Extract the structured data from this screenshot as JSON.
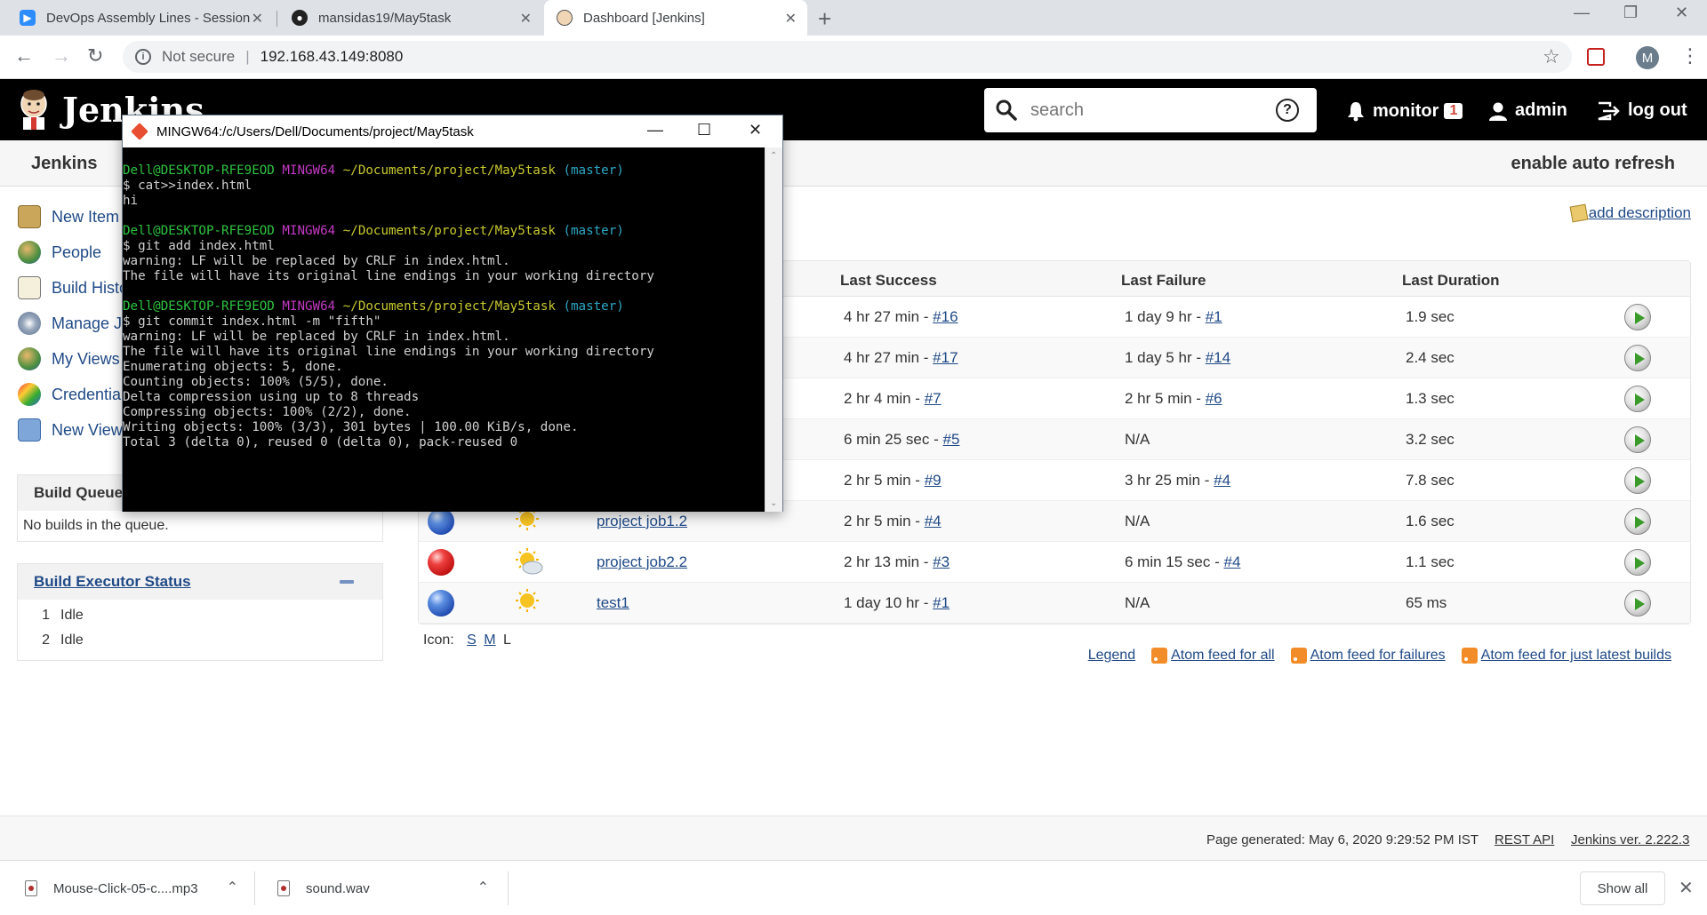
{
  "browser": {
    "tabs": [
      {
        "title": "DevOps Assembly Lines - Session",
        "icon": "zoom-icon",
        "active": false
      },
      {
        "title": "mansidas19/May5task",
        "icon": "github-icon",
        "active": false
      },
      {
        "title": "Dashboard [Jenkins]",
        "icon": "jenkins-icon",
        "active": true
      }
    ],
    "security_label": "Not secure",
    "url": "192.168.43.149:8080",
    "profile_initial": "M"
  },
  "header": {
    "title": "Jenkins",
    "search_placeholder": "search",
    "help": "?",
    "monitor_label": "monitor",
    "monitor_count": "1",
    "user": "admin",
    "logout": "log out"
  },
  "breadcrumb": {
    "home": "Jenkins",
    "auto_refresh": "enable auto refresh"
  },
  "sidebar": {
    "items": [
      {
        "label": "New Item",
        "icon": "new-item-icon"
      },
      {
        "label": "People",
        "icon": "people-icon"
      },
      {
        "label": "Build History",
        "icon": "build-history-icon"
      },
      {
        "label": "Manage Jenkins",
        "icon": "manage-icon"
      },
      {
        "label": "My Views",
        "icon": "my-views-icon"
      },
      {
        "label": "Credentials",
        "icon": "credentials-icon"
      },
      {
        "label": "New View",
        "icon": "new-view-icon"
      }
    ],
    "build_queue": {
      "title": "Build Queue",
      "empty": "No builds in the queue."
    },
    "executors": {
      "title": "Build Executor Status",
      "rows": [
        {
          "num": "1",
          "state": "Idle"
        },
        {
          "num": "2",
          "state": "Idle"
        }
      ]
    }
  },
  "main": {
    "add_description": "add description",
    "columns": {
      "last_success": "Last Success",
      "last_failure": "Last Failure",
      "last_duration": "Last Duration"
    },
    "jobs": [
      {
        "status": "",
        "weather": "",
        "name": "",
        "success_time": "4 hr 27 min - ",
        "success_build": "#16",
        "failure_time": "1 day 9 hr - ",
        "failure_build": "#1",
        "duration": "1.9 sec"
      },
      {
        "status": "",
        "weather": "",
        "name": "",
        "success_time": "4 hr 27 min - ",
        "success_build": "#17",
        "failure_time": "1 day 5 hr - ",
        "failure_build": "#14",
        "duration": "2.4 sec"
      },
      {
        "status": "",
        "weather": "",
        "name": "",
        "success_time": "2 hr 4 min - ",
        "success_build": "#7",
        "failure_time": "2 hr 5 min - ",
        "failure_build": "#6",
        "duration": "1.3 sec"
      },
      {
        "status": "",
        "weather": "",
        "name": "",
        "success_time": "6 min 25 sec - ",
        "success_build": "#5",
        "failure_time": "N/A",
        "failure_build": "",
        "duration": "3.2 sec"
      },
      {
        "status": "",
        "weather": "",
        "name": "",
        "success_time": "2 hr 5 min - ",
        "success_build": "#9",
        "failure_time": "3 hr 25 min - ",
        "failure_build": "#4",
        "duration": "7.8 sec"
      },
      {
        "status": "blue",
        "weather": "sunny",
        "name": "project job1.2",
        "success_time": "2 hr 5 min - ",
        "success_build": "#4",
        "failure_time": "N/A",
        "failure_build": "",
        "duration": "1.6 sec"
      },
      {
        "status": "red",
        "weather": "partly-cloudy",
        "name": "project job2.2",
        "success_time": "2 hr 13 min - ",
        "success_build": "#3",
        "failure_time": "6 min 15 sec - ",
        "failure_build": "#4",
        "duration": "1.1 sec"
      },
      {
        "status": "blue",
        "weather": "sunny",
        "name": "test1",
        "success_time": "1 day 10 hr - ",
        "success_build": "#1",
        "failure_time": "N/A",
        "failure_build": "",
        "duration": "65 ms"
      }
    ],
    "icon_size": {
      "label": "Icon:",
      "s": "S",
      "m": "M",
      "l": "L"
    },
    "feeds": {
      "legend": "Legend",
      "all": "Atom feed for all",
      "failures": "Atom feed for failures",
      "latest": "Atom feed for just latest builds"
    }
  },
  "footer": {
    "generated": "Page generated: May 6, 2020 9:29:52 PM IST",
    "rest_api": "REST API",
    "version": "Jenkins ver. 2.222.3"
  },
  "downloads": {
    "items": [
      {
        "name": "Mouse-Click-05-c....mp3"
      },
      {
        "name": "sound.wav"
      }
    ],
    "show_all": "Show all"
  },
  "terminal": {
    "title": "MINGW64:/c/Users/Dell/Documents/project/May5task",
    "prompt_user": "Dell@DESKTOP-RFE9EOD",
    "prompt_env": "MINGW64",
    "prompt_path": "~/Documents/project/May5task",
    "prompt_branch": "(master)",
    "blocks": [
      {
        "cmd": "$ cat>>index.html",
        "output": [
          "hi"
        ]
      },
      {
        "cmd": "$ git add index.html",
        "output": [
          "warning: LF will be replaced by CRLF in index.html.",
          "The file will have its original line endings in your working directory"
        ]
      },
      {
        "cmd": "$ git commit index.html -m \"fifth\"",
        "output": [
          "warning: LF will be replaced by CRLF in index.html.",
          "The file will have its original line endings in your working directory",
          "Enumerating objects: 5, done.",
          "Counting objects: 100% (5/5), done.",
          "Delta compression using up to 8 threads",
          "Compressing objects: 100% (2/2), done.",
          "Writing objects: 100% (3/3), 301 bytes | 100.00 KiB/s, done.",
          "Total 3 (delta 0), reused 0 (delta 0), pack-reused 0"
        ]
      }
    ]
  }
}
